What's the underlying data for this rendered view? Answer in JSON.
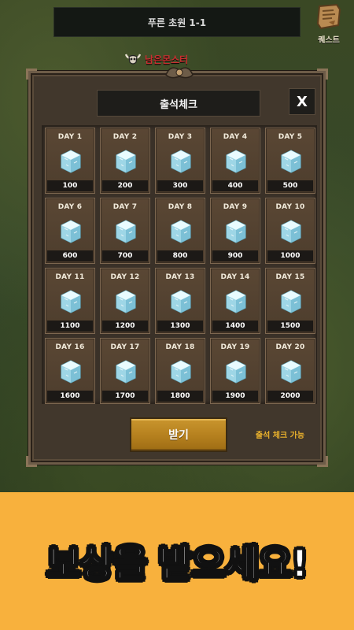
{
  "hud": {
    "stage_title": "푸른 초원 1-1",
    "quest_label": "퀘스트",
    "monster_label": "남은몬스터",
    "icons": {
      "quest": "quest-scroll-icon",
      "monster": "bull-skull-icon"
    }
  },
  "dialog": {
    "title": "출석체크",
    "close_label": "X",
    "receive_label": "받기",
    "status_text": "출석 체크 가능",
    "days": [
      {
        "label": "DAY 1",
        "amount": "100"
      },
      {
        "label": "DAY 2",
        "amount": "200"
      },
      {
        "label": "DAY 3",
        "amount": "300"
      },
      {
        "label": "DAY 4",
        "amount": "400"
      },
      {
        "label": "DAY 5",
        "amount": "500"
      },
      {
        "label": "DAY 6",
        "amount": "600"
      },
      {
        "label": "DAY 7",
        "amount": "700"
      },
      {
        "label": "DAY 8",
        "amount": "800"
      },
      {
        "label": "DAY 9",
        "amount": "900"
      },
      {
        "label": "DAY 10",
        "amount": "1000"
      },
      {
        "label": "DAY 11",
        "amount": "1100"
      },
      {
        "label": "DAY 12",
        "amount": "1200"
      },
      {
        "label": "DAY 13",
        "amount": "1300"
      },
      {
        "label": "DAY 14",
        "amount": "1400"
      },
      {
        "label": "DAY 15",
        "amount": "1500"
      },
      {
        "label": "DAY 16",
        "amount": "1600"
      },
      {
        "label": "DAY 17",
        "amount": "1700"
      },
      {
        "label": "DAY 18",
        "amount": "1800"
      },
      {
        "label": "DAY 19",
        "amount": "1900"
      },
      {
        "label": "DAY 20",
        "amount": "2000"
      }
    ],
    "reward_icon": "ice-crystal-icon"
  },
  "banner": {
    "text": "보상을 받으세요!"
  },
  "colors": {
    "banner_bg": "#f8b13d",
    "button_gold": "#b5801e",
    "status_text": "#e8b02c",
    "panel_brown": "#41372c"
  }
}
